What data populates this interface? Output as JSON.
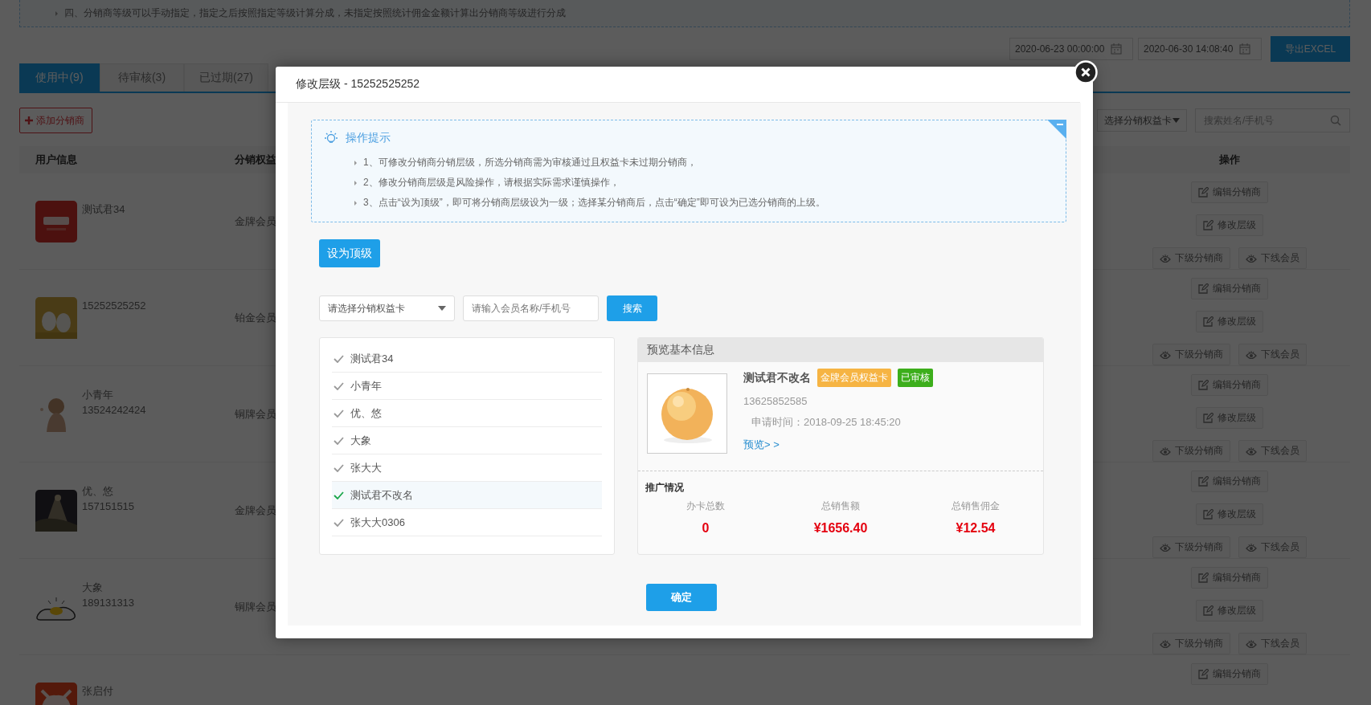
{
  "notice": {
    "text": "四、分销商等级可以手动指定，指定之后按照指定等级计算分成，未指定按照统计佣金金额计算出分销商等级进行分成"
  },
  "date_range": {
    "start": "2020-06-23 00:00:00",
    "end": "2020-06-30 14:08:40"
  },
  "export_button": "导出EXCEL",
  "tabs": [
    {
      "label": "使用中(9)",
      "selected": true
    },
    {
      "label": "待审核(3)",
      "selected": false
    },
    {
      "label": "已过期(27)",
      "selected": false
    }
  ],
  "add_button": "添加分销商",
  "filters": {
    "card_select": "选择分销权益卡",
    "search_placeholder": "搜索姓名/手机号"
  },
  "table": {
    "columns": [
      "用户信息",
      "分销权益",
      "操作"
    ],
    "rows": [
      {
        "name": "测试君34",
        "card": "金牌会员",
        "actions": [
          {
            "label": "编辑分销商",
            "kind": "edit"
          },
          {
            "label": "修改层级",
            "kind": "edit"
          },
          {
            "label": "下级分销商",
            "kind": "view"
          },
          {
            "label": "下线会员",
            "kind": "view"
          }
        ]
      },
      {
        "name": "15252525252",
        "card": "铂金会员",
        "actions": [
          {
            "label": "编辑分销商",
            "kind": "edit"
          },
          {
            "label": "修改层级",
            "kind": "edit"
          },
          {
            "label": "下级分销商",
            "kind": "view"
          },
          {
            "label": "下线会员",
            "kind": "view"
          }
        ]
      },
      {
        "name": "小青年",
        "phone": "13524242424",
        "card": "铜牌会员",
        "actions": [
          {
            "label": "编辑分销商",
            "kind": "edit"
          },
          {
            "label": "修改层级",
            "kind": "edit"
          },
          {
            "label": "下级分销商",
            "kind": "view"
          },
          {
            "label": "下线会员",
            "kind": "view"
          }
        ]
      },
      {
        "name": "优、悠",
        "phone": "157151515",
        "card": "金牌会员",
        "actions": [
          {
            "label": "编辑分销商",
            "kind": "edit"
          },
          {
            "label": "修改层级",
            "kind": "edit"
          },
          {
            "label": "下级分销商",
            "kind": "view"
          },
          {
            "label": "下线会员",
            "kind": "view"
          }
        ]
      },
      {
        "name": "大象",
        "phone": "189131313",
        "card": "铜牌会员",
        "actions": [
          {
            "label": "编辑分销商",
            "kind": "edit"
          },
          {
            "label": "修改层级",
            "kind": "edit"
          },
          {
            "label": "下级分销商",
            "kind": "view"
          },
          {
            "label": "下线会员",
            "kind": "view"
          }
        ]
      },
      {
        "name": "张启付",
        "actions": [
          {
            "label": "编辑分销商",
            "kind": "edit"
          }
        ]
      }
    ]
  },
  "dialog": {
    "title": "修改层级 - 15252525252",
    "tips": {
      "title": "操作提示",
      "items": [
        "1、可修改分销商分销层级，所选分销商需为审核通过且权益卡未过期分销商，",
        "2、修改分销商层级是风险操作，请根据实际需求谨慎操作，",
        "3、点击“设为顶级”，即可将分销商层级设为一级；选择某分销商后，点击“确定”即可设为已选分销商的上级。"
      ]
    },
    "top_button": "设为顶级",
    "card_select": "请选择分销权益卡",
    "keyword_placeholder": "请输入会员名称/手机号",
    "search_button": "搜索",
    "members": [
      {
        "name": "测试君34",
        "selected": false
      },
      {
        "name": "小青年",
        "selected": false
      },
      {
        "name": "优、悠",
        "selected": false
      },
      {
        "name": "大象",
        "selected": false
      },
      {
        "name": "张大大",
        "selected": false
      },
      {
        "name": "测试君不改名",
        "selected": true
      },
      {
        "name": "张大大0306",
        "selected": false
      }
    ],
    "preview": {
      "header": "预览基本信息",
      "name": "测试君不改名",
      "tags": [
        {
          "label": "金牌会员权益卡",
          "color": "#f6b443"
        },
        {
          "label": "已审核",
          "color": "#3cae1b"
        }
      ],
      "phone": "13625852585",
      "apply_time": "申请时间：2018-09-25 18:45:20",
      "link": "预览> >",
      "stats_title": "推广情况",
      "stats": [
        {
          "label": "办卡总数",
          "value": "0"
        },
        {
          "label": "总销售额",
          "value": "¥1656.40"
        },
        {
          "label": "总销售佣金",
          "value": "¥12.54"
        }
      ]
    },
    "confirm_button": "确定"
  }
}
